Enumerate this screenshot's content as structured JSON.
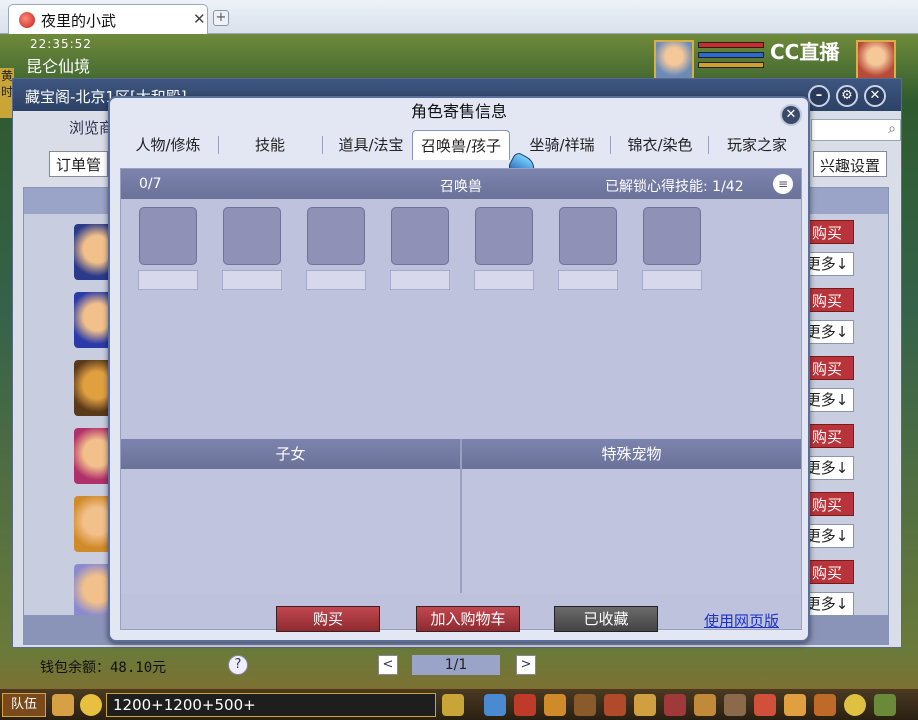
{
  "browser": {
    "tab_title": "夜里的小武",
    "close_glyph": "✕",
    "new_tab_glyph": "+"
  },
  "game_hud": {
    "clock": "22:35:52",
    "location": "昆仑仙境",
    "coord": "黄 时",
    "stream_logo": "CC直播"
  },
  "back_window": {
    "title": "藏宝阁-北京1区[太和殿]",
    "browse_label": "浏览商",
    "order_label": "订单管",
    "interest_label": "兴趣设置",
    "row_buy_label": "购买",
    "row_more_label": "更多↓",
    "wallet_label": "钱包余额：48.10元",
    "help_glyph": "?",
    "pager": {
      "prev": "<",
      "page": "1/1",
      "next": ">"
    }
  },
  "taskbar": {
    "team_label": "队伍",
    "chat_input_value": "1200+1200+500+"
  },
  "dialog": {
    "title": "角色寄售信息",
    "close_glyph": "✕",
    "tabs": [
      {
        "label": "人物/修炼",
        "active": false
      },
      {
        "label": "技能",
        "active": false
      },
      {
        "label": "道具/法宝",
        "active": false
      },
      {
        "label": "召唤兽/孩子",
        "active": true
      },
      {
        "label": "坐骑/祥瑞",
        "active": false
      },
      {
        "label": "锦衣/染色",
        "active": false
      },
      {
        "label": "玩家之家",
        "active": false
      }
    ],
    "summon_panel": {
      "count": "0/7",
      "title": "召唤兽",
      "unlocked_skills": "已解锁心得技能: 1/42",
      "list_glyph": "≡",
      "slot_count": 7
    },
    "children_title": "子女",
    "special_pet_title": "特殊宠物",
    "buttons": {
      "buy": "购买",
      "add_to_cart": "加入购物车",
      "favorited": "已收藏",
      "web_version": "使用网页版"
    }
  }
}
